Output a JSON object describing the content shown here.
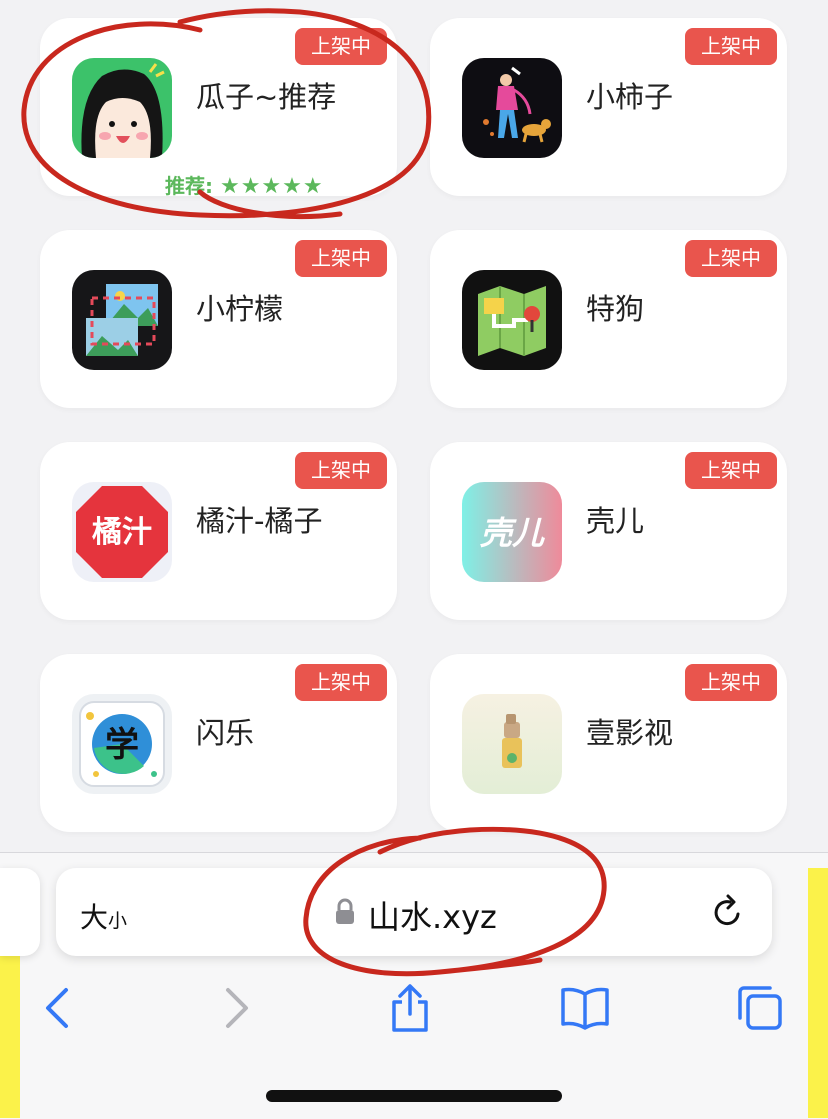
{
  "apps": [
    {
      "name": "瓜子~推荐",
      "badge": "上架中",
      "icon": "cartoon-face-icon",
      "rating_label": "推荐:",
      "rating_stars": "★★★★★"
    },
    {
      "name": "小柿子",
      "badge": "上架中",
      "icon": "walking-dog-illustration-icon"
    },
    {
      "name": "小柠檬",
      "badge": "上架中",
      "icon": "photo-crop-icon"
    },
    {
      "name": "特狗",
      "badge": "上架中",
      "icon": "map-pin-icon"
    },
    {
      "name": "橘汁-橘子",
      "badge": "上架中",
      "icon": "juzhi-logo-icon",
      "icon_text": "橘汁"
    },
    {
      "name": "壳儿",
      "badge": "上架中",
      "icon": "keer-logo-icon",
      "icon_text": "壳儿"
    },
    {
      "name": "闪乐",
      "badge": "上架中",
      "icon": "xue-logo-icon",
      "icon_text": "学"
    },
    {
      "name": "壹影视",
      "badge": "上架中",
      "icon": "recycle-bin-icon"
    }
  ],
  "browser": {
    "text_size_label_big": "大",
    "text_size_label_small": "小",
    "url": "山水.xyz"
  },
  "colors": {
    "badge": "#e9554d",
    "rating": "#5cb85c",
    "toolbar_active": "#3478f6",
    "toolbar_disabled": "#b5b5ba",
    "annotation": "#c8281e"
  }
}
